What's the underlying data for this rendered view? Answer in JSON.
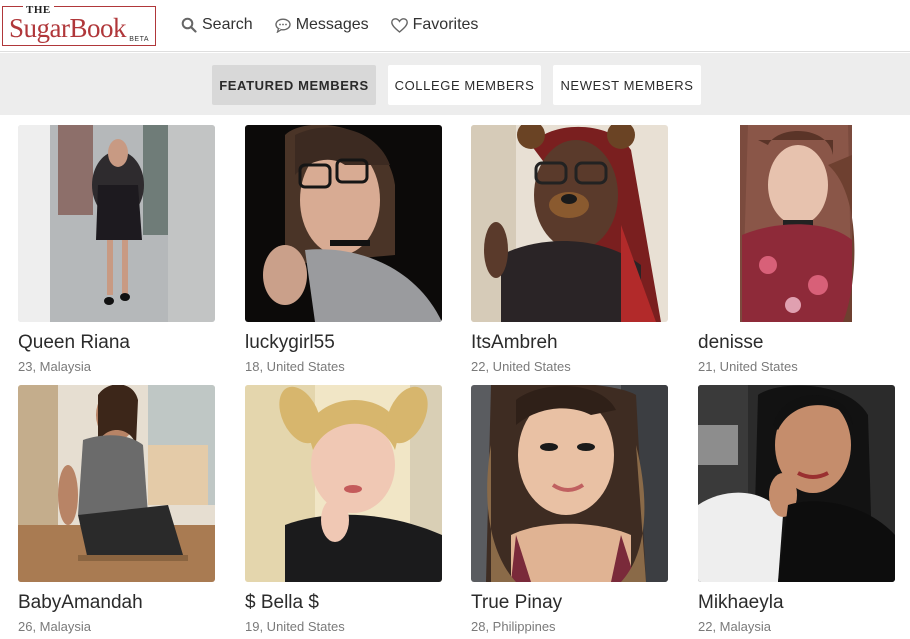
{
  "brand": {
    "the": "THE",
    "name": "SugarBook",
    "badge": "BETA",
    "accent": "#b0373a"
  },
  "nav": [
    {
      "label": "Search",
      "icon": "search-icon"
    },
    {
      "label": "Messages",
      "icon": "chat-bubble-icon"
    },
    {
      "label": "Favorites",
      "icon": "heart-icon"
    }
  ],
  "tabs": [
    {
      "label": "FEATURED MEMBERS",
      "active": true
    },
    {
      "label": "COLLEGE MEMBERS",
      "active": false
    },
    {
      "label": "NEWEST MEMBERS",
      "active": false
    }
  ],
  "members": [
    {
      "name": "Queen Riana",
      "details": "23, Malaysia"
    },
    {
      "name": "luckygirl55",
      "details": "18, United States"
    },
    {
      "name": "ItsAmbreh",
      "details": "22, United States"
    },
    {
      "name": "denisse",
      "details": "21, United States"
    },
    {
      "name": "BabyAmandah",
      "details": "26, Malaysia"
    },
    {
      "name": "$ Bella $",
      "details": "19, United States"
    },
    {
      "name": "True Pinay",
      "details": "28, Philippines"
    },
    {
      "name": "Mikhaeyla",
      "details": "22, Malaysia"
    }
  ]
}
